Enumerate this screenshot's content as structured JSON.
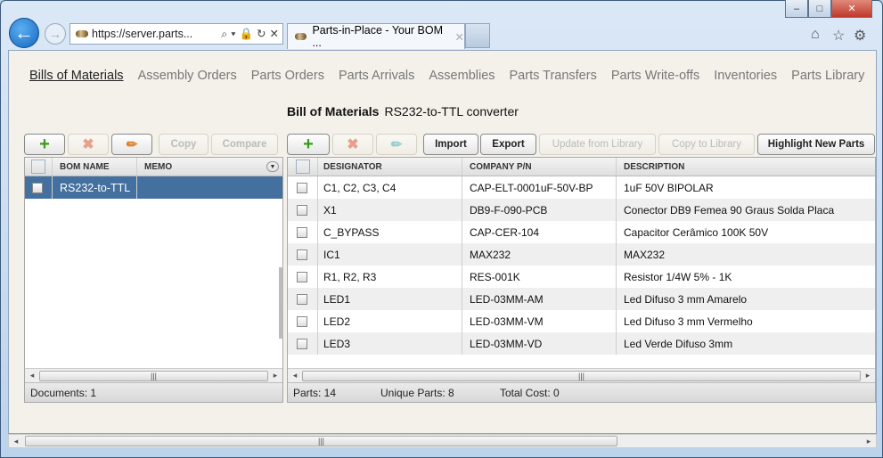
{
  "browser": {
    "url": "https://server.parts...",
    "tab_title": "Parts-in-Place - Your BOM ..."
  },
  "nav": [
    "Bills of Materials",
    "Assembly Orders",
    "Parts Orders",
    "Parts Arrivals",
    "Assemblies",
    "Parts Transfers",
    "Parts Write-offs",
    "Inventories",
    "Parts Library"
  ],
  "title": {
    "label": "Bill of Materials",
    "value": "RS232-to-TTL converter"
  },
  "left_toolbar": {
    "copy": "Copy",
    "compare": "Compare"
  },
  "right_toolbar": {
    "import": "Import",
    "export": "Export",
    "update": "Update from Library",
    "copy_to": "Copy to Library",
    "highlight": "Highlight New Parts"
  },
  "left_grid": {
    "columns": [
      "BOM NAME",
      "MEMO"
    ],
    "rows": [
      {
        "name": "RS232-to-TTL",
        "memo": ""
      }
    ],
    "status": "Documents: 1"
  },
  "right_grid": {
    "columns": [
      "DESIGNATOR",
      "COMPANY P/N",
      "DESCRIPTION"
    ],
    "rows": [
      [
        "C1, C2, C3, C4",
        "CAP-ELT-0001uF-50V-BP",
        "1uF 50V BIPOLAR"
      ],
      [
        "X1",
        "DB9-F-090-PCB",
        "Conector DB9 Femea 90 Graus Solda Placa"
      ],
      [
        "C_BYPASS",
        "CAP-CER-104",
        "Capacitor Cerâmico 100K 50V"
      ],
      [
        "IC1",
        "MAX232",
        "MAX232"
      ],
      [
        "R1, R2, R3",
        "RES-001K",
        "Resistor 1/4W 5% - 1K"
      ],
      [
        "LED1",
        "LED-03MM-AM",
        "Led Difuso 3 mm Amarelo"
      ],
      [
        "LED2",
        "LED-03MM-VM",
        "Led Difuso 3 mm Vermelho"
      ],
      [
        "LED3",
        "LED-03MM-VD",
        "Led Verde Difuso 3mm"
      ]
    ],
    "status": {
      "parts": "Parts: 14",
      "unique": "Unique Parts: 8",
      "cost": "Total Cost: 0"
    }
  }
}
